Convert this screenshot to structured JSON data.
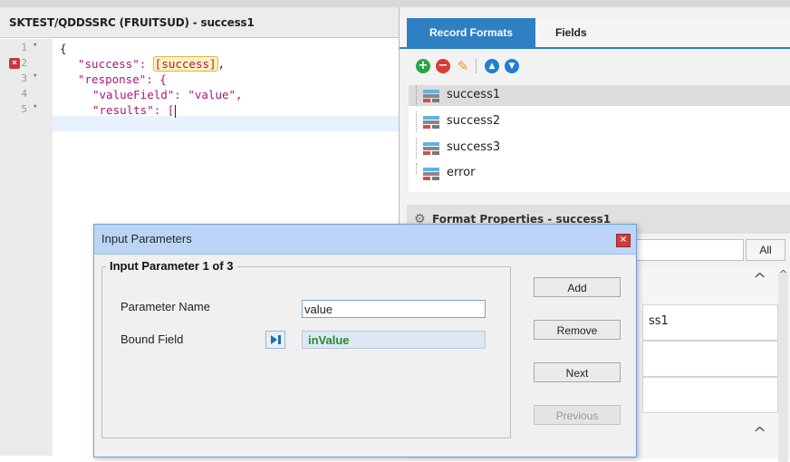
{
  "editor": {
    "title": "SKTEST/QDDSSRC (FRUITSUD) - success1",
    "lines": [
      {
        "num": "1",
        "fold": "▾",
        "error": false
      },
      {
        "num": "2",
        "fold": "",
        "error": true
      },
      {
        "num": "3",
        "fold": "▾",
        "error": false
      },
      {
        "num": "4",
        "fold": "",
        "error": false
      },
      {
        "num": "5",
        "fold": "▾",
        "error": false
      }
    ],
    "code": {
      "l1": "{",
      "l2_key": "\"success\": ",
      "l2_badge": "[success]",
      "l2_tail": ",",
      "l3_key": "\"response\": {",
      "l4_key": "\"valueField\": ",
      "l4_val": "\"value\",",
      "l5_key": "\"results\": ["
    }
  },
  "right": {
    "tabs": [
      "Record Formats",
      "Fields"
    ],
    "toolbar_icons": [
      "add-icon",
      "remove-icon",
      "edit-pencil-icon",
      "move-up-icon",
      "move-down-icon"
    ],
    "record_formats": [
      "success1",
      "success2",
      "success3",
      "error"
    ],
    "selected": "success1",
    "format_properties_title": "Format Properties - success1",
    "all_button": "All",
    "prop_value_partial": "ss1"
  },
  "dialog": {
    "title": "Input Parameters",
    "group_title": "Input Parameter 1 of 3",
    "parameter_name_label": "Parameter Name",
    "parameter_name_value": "value",
    "bound_field_label": "Bound Field",
    "bound_field_value": "inValue",
    "buttons": {
      "add": "Add",
      "remove": "Remove",
      "next": "Next",
      "previous": "Previous"
    }
  },
  "colors": {
    "accent": "#2f7fc3",
    "string": "#a8167a",
    "bound_field_text": "#2a8a2a",
    "error": "#c9363d"
  }
}
